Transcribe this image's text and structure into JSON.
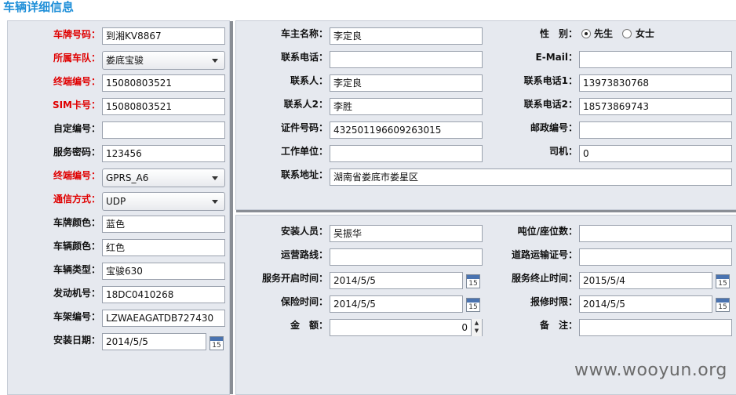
{
  "title": "车辆详细信息",
  "watermark": "www.wooyun.org",
  "calendar_icon_text": "15",
  "left": {
    "plate_number": {
      "label": "车牌号码：",
      "value": "到湘KV8867"
    },
    "fleet": {
      "label": "所属车队：",
      "value": "娄底宝骏"
    },
    "terminal_no": {
      "label": "终端编号：",
      "value": "15080803521"
    },
    "sim_no": {
      "label": "SIM卡号：",
      "value": "15080803521"
    },
    "custom_no": {
      "label": "自定编号：",
      "value": ""
    },
    "service_password": {
      "label": "服务密码：",
      "value": "123456"
    },
    "terminal_code": {
      "label": "终端编号：",
      "value": "GPRS_A6"
    },
    "comm_mode": {
      "label": "通信方式：",
      "value": "UDP"
    },
    "plate_color": {
      "label": "车牌颜色：",
      "value": "蓝色"
    },
    "vehicle_color": {
      "label": "车辆颜色：",
      "value": "红色"
    },
    "vehicle_type": {
      "label": "车辆类型：",
      "value": "宝骏630"
    },
    "engine_no": {
      "label": "发动机号：",
      "value": "18DC0410268"
    },
    "frame_no": {
      "label": "车架编号：",
      "value": "LZWAEAGATDB727430"
    },
    "install_date": {
      "label": "安装日期：",
      "value": "2014/5/5"
    }
  },
  "owner": {
    "owner_name": {
      "label": "车主名称：",
      "value": "李定良"
    },
    "gender": {
      "label": "性　别：",
      "options": [
        "先生",
        "女士"
      ],
      "selected": "先生"
    },
    "phone": {
      "label": "联系电话：",
      "value": ""
    },
    "email": {
      "label": "E-Mail：",
      "value": ""
    },
    "contact": {
      "label": "联系人：",
      "value": "李定良"
    },
    "phone1": {
      "label": "联系电话1：",
      "value": "13973830768"
    },
    "contact2": {
      "label": "联系人2：",
      "value": "李胜"
    },
    "phone2": {
      "label": "联系电话2：",
      "value": "18573869743"
    },
    "id_no": {
      "label": "证件号码：",
      "value": "432501196609263015"
    },
    "postcode": {
      "label": "邮政编号：",
      "value": ""
    },
    "workplace": {
      "label": "工作单位：",
      "value": ""
    },
    "driver": {
      "label": "司机：",
      "value": "0"
    },
    "address": {
      "label": "联系地址：",
      "value": "湖南省娄底市娄星区"
    }
  },
  "service": {
    "installer": {
      "label": "安装人员：",
      "value": "吴振华"
    },
    "tonnage": {
      "label": "吨位/座位数：",
      "value": ""
    },
    "route": {
      "label": "运营路线：",
      "value": ""
    },
    "transport_cert": {
      "label": "道路运输证号：",
      "value": ""
    },
    "service_start": {
      "label": "服务开启时间：",
      "value": "2014/5/5"
    },
    "service_end": {
      "label": "服务终止时间：",
      "value": "2015/5/4"
    },
    "insurance_time": {
      "label": "保险时间：",
      "value": "2014/5/5"
    },
    "scrap_limit": {
      "label": "报修时限：",
      "value": "2014/5/5"
    },
    "amount": {
      "label": "金　额：",
      "value": "0"
    },
    "remark": {
      "label": "备　注：",
      "value": ""
    }
  }
}
